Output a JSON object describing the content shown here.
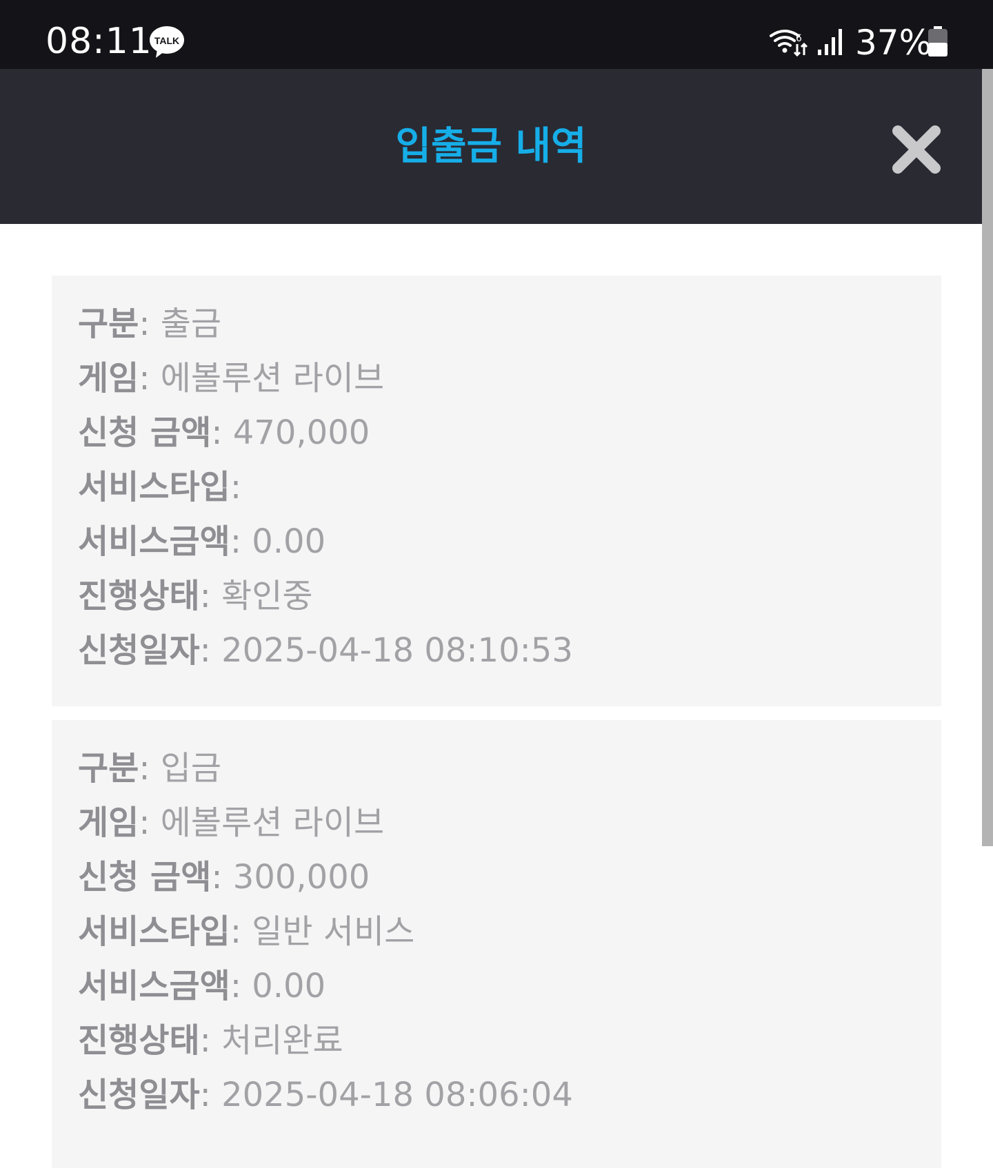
{
  "status_bar": {
    "time": "08:11",
    "notification_icon": "kakaotalk-icon",
    "talk_label": "TALK",
    "battery_percent": "37%"
  },
  "header": {
    "title": "입출금 내역",
    "title_color": "#16aee8",
    "close_icon": "close-icon"
  },
  "colon": ": ",
  "records": [
    {
      "fields": [
        {
          "label": "구분",
          "value": "출금"
        },
        {
          "label": "게임",
          "value": "에볼루션 라이브"
        },
        {
          "label": "신청 금액",
          "value": "470,000"
        },
        {
          "label": "서비스타입",
          "value": ""
        },
        {
          "label": "서비스금액",
          "value": "0.00"
        },
        {
          "label": "진행상태",
          "value": "확인중"
        },
        {
          "label": "신청일자",
          "value": "2025-04-18 08:10:53"
        }
      ]
    },
    {
      "fields": [
        {
          "label": "구분",
          "value": "입금"
        },
        {
          "label": "게임",
          "value": "에볼루션 라이브"
        },
        {
          "label": "신청 금액",
          "value": "300,000"
        },
        {
          "label": "서비스타입",
          "value": "일반 서비스"
        },
        {
          "label": "서비스금액",
          "value": "0.00"
        },
        {
          "label": "진행상태",
          "value": "처리완료"
        },
        {
          "label": "신청일자",
          "value": "2025-04-18 08:06:04"
        }
      ]
    }
  ]
}
